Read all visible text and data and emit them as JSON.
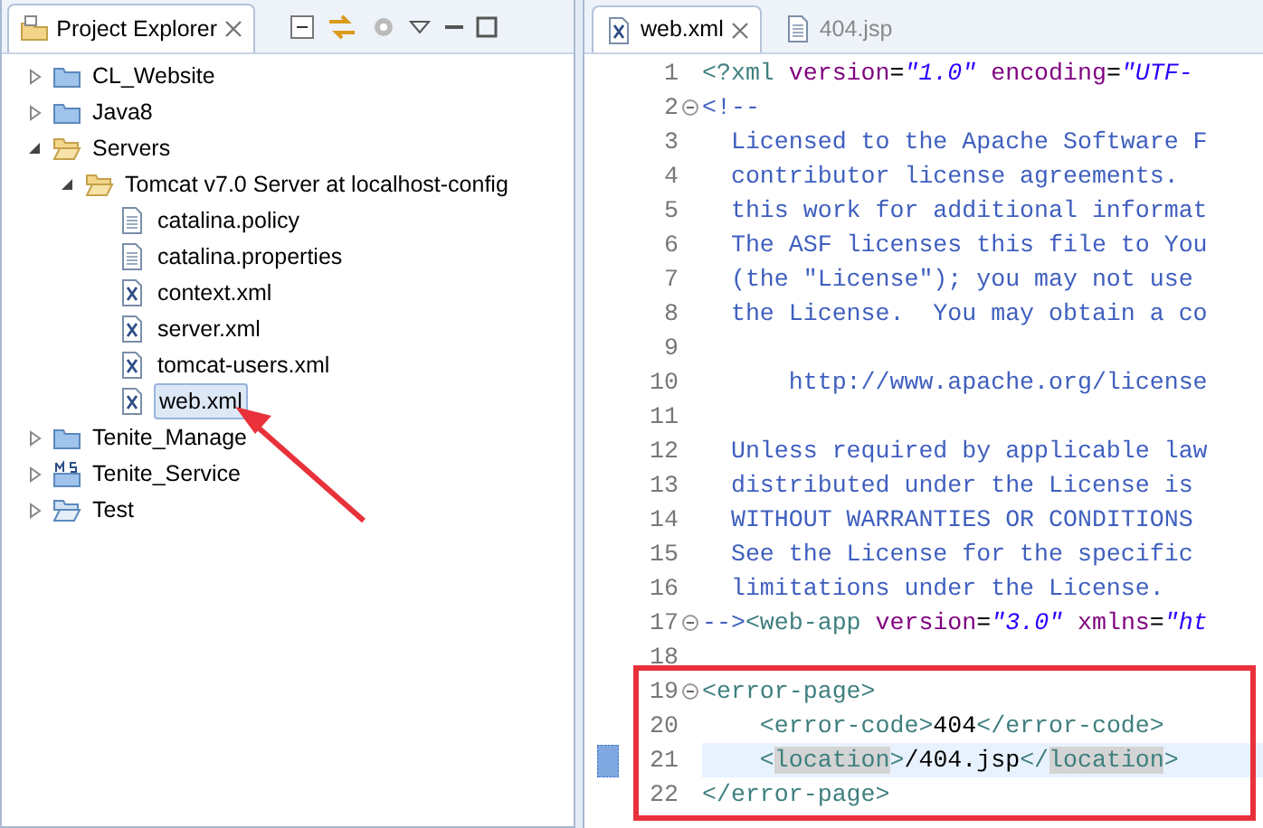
{
  "explorer": {
    "title": "Project Explorer",
    "tree": [
      {
        "label": "CL_Website",
        "kind": "project",
        "expanded": false,
        "selected": false
      },
      {
        "label": "Java8",
        "kind": "project",
        "expanded": false,
        "selected": false
      },
      {
        "label": "Servers",
        "kind": "open_folder",
        "expanded": true,
        "selected": false,
        "children": [
          {
            "label": "Tomcat v7.0 Server at localhost-config",
            "kind": "open_folder",
            "expanded": true,
            "selected": false,
            "children": [
              {
                "label": "catalina.policy",
                "kind": "file",
                "selected": false
              },
              {
                "label": "catalina.properties",
                "kind": "file",
                "selected": false
              },
              {
                "label": "context.xml",
                "kind": "xml",
                "selected": false
              },
              {
                "label": "server.xml",
                "kind": "xml",
                "selected": false
              },
              {
                "label": "tomcat-users.xml",
                "kind": "xml",
                "selected": false
              },
              {
                "label": "web.xml",
                "kind": "xml",
                "selected": true
              }
            ]
          }
        ]
      },
      {
        "label": "Tenite_Manage",
        "kind": "project",
        "expanded": false,
        "selected": false
      },
      {
        "label": "Tenite_Service",
        "kind": "service",
        "expanded": false,
        "selected": false
      },
      {
        "label": "Test",
        "kind": "open_project",
        "expanded": false,
        "selected": false
      }
    ],
    "annotation_arrow": true
  },
  "editor": {
    "tabs": [
      {
        "label": "web.xml",
        "kind": "xml",
        "selected": true
      },
      {
        "label": "404.jsp",
        "kind": "file",
        "selected": false
      }
    ],
    "lines": [
      {
        "number": "1",
        "segments": [
          {
            "kind": "tag",
            "text": "<?xml"
          },
          {
            "kind": "attr",
            "text": " version"
          },
          {
            "kind": "text",
            "text": "="
          },
          {
            "kind": "value",
            "text": "\"1.0\""
          },
          {
            "kind": "attr",
            "text": " encoding"
          },
          {
            "kind": "text",
            "text": "="
          },
          {
            "kind": "value",
            "text": "\"UTF-"
          }
        ]
      },
      {
        "number": "2",
        "foldable": true,
        "segments": [
          {
            "kind": "comment",
            "text": "<!--"
          }
        ]
      },
      {
        "number": "3",
        "segments": [
          {
            "kind": "comment",
            "text": "  Licensed to the Apache Software F"
          }
        ]
      },
      {
        "number": "4",
        "segments": [
          {
            "kind": "comment",
            "text": "  contributor license agreements."
          }
        ]
      },
      {
        "number": "5",
        "segments": [
          {
            "kind": "comment",
            "text": "  this work for additional informat"
          }
        ]
      },
      {
        "number": "6",
        "segments": [
          {
            "kind": "comment",
            "text": "  The ASF licenses this file to You"
          }
        ]
      },
      {
        "number": "7",
        "segments": [
          {
            "kind": "comment",
            "text": "  (the \"License\"); you may not use"
          }
        ]
      },
      {
        "number": "8",
        "segments": [
          {
            "kind": "comment",
            "text": "  the License.  You may obtain a co"
          }
        ]
      },
      {
        "number": "9"
      },
      {
        "number": "10",
        "segments": [
          {
            "kind": "comment",
            "text": "      http://www.apache.org/license"
          }
        ]
      },
      {
        "number": "11"
      },
      {
        "number": "12",
        "segments": [
          {
            "kind": "comment",
            "text": "  Unless required by applicable law"
          }
        ]
      },
      {
        "number": "13",
        "segments": [
          {
            "kind": "comment",
            "text": "  distributed under the License is"
          }
        ]
      },
      {
        "number": "14",
        "segments": [
          {
            "kind": "comment",
            "text": "  WITHOUT WARRANTIES OR CONDITIONS"
          }
        ]
      },
      {
        "number": "15",
        "segments": [
          {
            "kind": "comment",
            "text": "  See the License for the specific"
          }
        ]
      },
      {
        "number": "16",
        "segments": [
          {
            "kind": "comment",
            "text": "  limitations under the License."
          }
        ]
      },
      {
        "number": "17",
        "foldable": true,
        "segments": [
          {
            "kind": "comment",
            "text": "-->"
          },
          {
            "kind": "tag",
            "text": "<web-app"
          },
          {
            "kind": "attr",
            "text": " version"
          },
          {
            "kind": "text",
            "text": "="
          },
          {
            "kind": "value",
            "text": "\"3.0\""
          },
          {
            "kind": "attr",
            "text": " xmlns"
          },
          {
            "kind": "text",
            "text": "="
          },
          {
            "kind": "value",
            "text": "\"ht"
          }
        ]
      },
      {
        "number": "18"
      },
      {
        "number": "19",
        "foldable": true,
        "boxed": true,
        "segments": [
          {
            "kind": "tag",
            "text": "<error-page>"
          }
        ]
      },
      {
        "number": "20",
        "boxed": true,
        "segments": [
          {
            "kind": "tag",
            "text": "    <error-code>"
          },
          {
            "kind": "text",
            "text": "404"
          },
          {
            "kind": "tag",
            "text": "</error-code>"
          }
        ]
      },
      {
        "number": "21",
        "boxed": true,
        "current": true,
        "segments": [
          {
            "kind": "tag",
            "text": "    <"
          },
          {
            "kind": "tag",
            "text": "location",
            "marked": true
          },
          {
            "kind": "tag",
            "text": ">"
          },
          {
            "kind": "text",
            "text": "/404.jsp"
          },
          {
            "kind": "tag",
            "text": "</"
          },
          {
            "kind": "tag",
            "text": "location",
            "marked": true
          },
          {
            "kind": "tag",
            "text": ">"
          }
        ]
      },
      {
        "number": "22",
        "boxed": true,
        "segments": [
          {
            "kind": "tag",
            "text": "</error-page>"
          }
        ]
      }
    ]
  }
}
